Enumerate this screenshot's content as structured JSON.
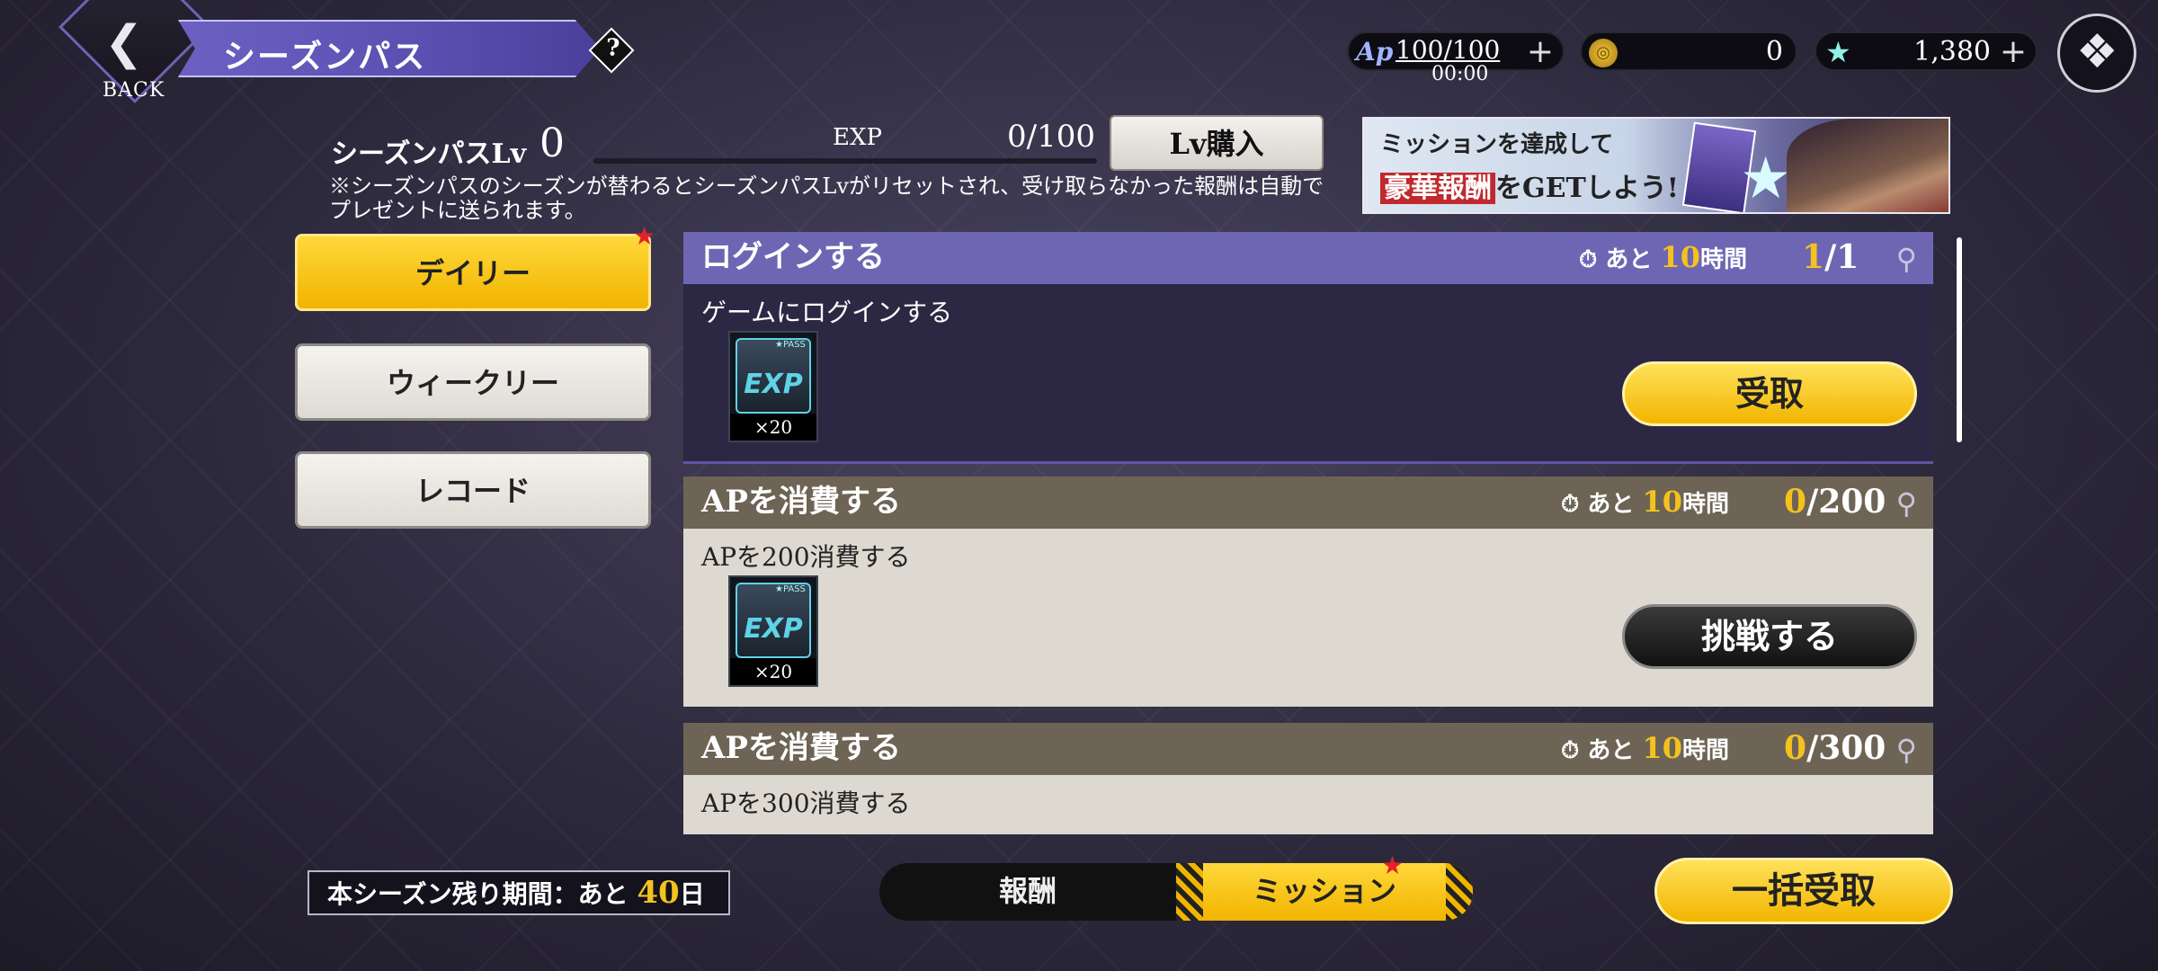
{
  "header": {
    "back_label": "BACK",
    "title": "シーズンパス",
    "help_label": "?",
    "ap_badge": "Ap",
    "ap_value": "100/100",
    "ap_timer": "00:00",
    "coin_value": "0",
    "gem_value": "1,380"
  },
  "level": {
    "label": "シーズンパスLv",
    "level": "0",
    "exp_label": "EXP",
    "exp_value": "0/100",
    "exp_progress": 0,
    "buy_label": "Lv購入",
    "notice": "※シーズンパスのシーズンが替わるとシーズンパスLvがリセットされ、受け取らなかった報酬は自動でプレゼントに送られます。"
  },
  "promo": {
    "line1": "ミッションを達成して",
    "line2_highlight": "豪華報酬",
    "line2_rest": "をGETしよう!"
  },
  "tabs": {
    "daily": "デイリー",
    "weekly": "ウィークリー",
    "record": "レコード",
    "selected": "daily"
  },
  "missions": [
    {
      "title": "ログインする",
      "time_prefix": "あと",
      "time_num": "10",
      "time_unit": "時間",
      "progress_cur": "1",
      "progress_total": "/1",
      "desc": "ゲームにログインする",
      "reward_icon": "EXP",
      "reward_pass": "★PASS",
      "reward_qty": "×20",
      "action": "受取"
    },
    {
      "title": "APを消費する",
      "time_prefix": "あと",
      "time_num": "10",
      "time_unit": "時間",
      "progress_cur": "0",
      "progress_total": "/200",
      "desc": "APを200消費する",
      "reward_icon": "EXP",
      "reward_pass": "★PASS",
      "reward_qty": "×20",
      "action": "挑戦する"
    },
    {
      "title": "APを消費する",
      "time_prefix": "あと",
      "time_num": "10",
      "time_unit": "時間",
      "progress_cur": "0",
      "progress_total": "/300",
      "desc": "APを300消費する"
    }
  ],
  "bottom": {
    "season_label": "本シーズン残り期間：あと",
    "season_days": "40",
    "season_unit": "日",
    "toggle_reward": "報酬",
    "toggle_mission": "ミッション",
    "claim_all": "一括受取"
  },
  "icons": {
    "timer": "stopwatch-icon",
    "search": "magnifier-icon",
    "new": "red-star-badge-icon"
  }
}
